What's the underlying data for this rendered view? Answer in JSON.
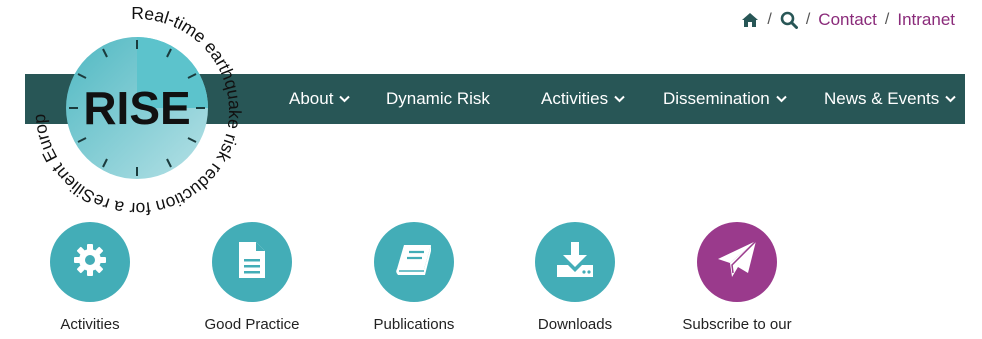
{
  "utility": {
    "home_icon": "home-icon",
    "search_icon": "search-icon",
    "separator": "/",
    "contact": "Contact",
    "intranet": "Intranet"
  },
  "logo": {
    "center_text": "RISE",
    "ring_text": "Real-time earthquake risk reduction for a reSilient Europe"
  },
  "nav": {
    "items": [
      {
        "label": "About",
        "has_dropdown": true
      },
      {
        "label": "Dynamic Risk",
        "has_dropdown": false
      },
      {
        "label": "Activities",
        "has_dropdown": true
      },
      {
        "label": "Dissemination",
        "has_dropdown": true
      },
      {
        "label": "News & Events",
        "has_dropdown": true
      }
    ]
  },
  "quick_links": [
    {
      "label": "Activities",
      "icon": "gear-icon",
      "color": "#43adb7"
    },
    {
      "label": "Good Practice",
      "icon": "document-icon",
      "color": "#43adb7"
    },
    {
      "label": "Publications",
      "icon": "book-icon",
      "color": "#43adb7"
    },
    {
      "label": "Downloads",
      "icon": "download-icon",
      "color": "#43adb7"
    },
    {
      "label": "Subscribe to our",
      "icon": "paper-plane-icon",
      "color": "#9a3a8c"
    }
  ],
  "colors": {
    "nav_bg": "#285656",
    "link": "#8a2b7a",
    "teal": "#43adb7",
    "purple": "#9a3a8c"
  }
}
